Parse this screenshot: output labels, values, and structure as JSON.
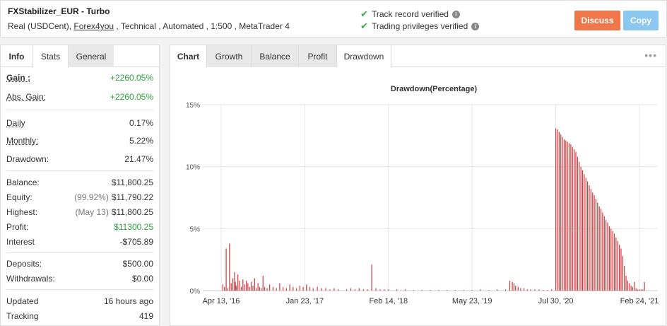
{
  "header": {
    "account_name": "FXStabilizer_EUR - Turbo",
    "sub_prefix": "Real (USDCent), ",
    "broker_link": "Forex4you",
    "sub_suffix": " , Technical , Automated , 1:500 , MetaTrader 4",
    "verified_1": "Track record verified",
    "verified_2": "Trading privileges verified",
    "discuss_label": "Discuss",
    "copy_label": "Copy",
    "colors": {
      "discuss": "#f0774c",
      "copy": "#8cc7ef",
      "check": "#39a845"
    }
  },
  "left_tabs": [
    "Info",
    "Stats",
    "General"
  ],
  "stats": {
    "gain": {
      "label": "Gain :",
      "value": "+2260.05%"
    },
    "abs_gain": {
      "label": "Abs. Gain:",
      "value": "+2260.05%"
    },
    "daily": {
      "label": "Daily",
      "value": "0.17%"
    },
    "monthly": {
      "label": "Monthly:",
      "value": "5.22%"
    },
    "drawdown": {
      "label": "Drawdown:",
      "value": "21.47%"
    },
    "balance": {
      "label": "Balance:",
      "value": "$11,800.25"
    },
    "equity": {
      "label": "Equity:",
      "prefix": "(99.92%)",
      "value": "$11,790.22"
    },
    "highest": {
      "label": "Highest:",
      "prefix": "(May 13)",
      "value": "$11,800.25"
    },
    "profit": {
      "label": "Profit:",
      "value": "$11300.25"
    },
    "interest": {
      "label": "Interest",
      "value": "-$705.89"
    },
    "deposits": {
      "label": "Deposits:",
      "value": "$500.00"
    },
    "withdrawals": {
      "label": "Withdrawals:",
      "value": "$0.00"
    },
    "updated": {
      "label": "Updated",
      "value": "16 hours ago"
    },
    "tracking": {
      "label": "Tracking",
      "value": "419"
    }
  },
  "right_tabs": [
    "Chart",
    "Growth",
    "Balance",
    "Profit",
    "Drawdown"
  ],
  "more_icon": "more-dots-icon",
  "chart_data": {
    "type": "bar",
    "title": "Drawdown(Percentage)",
    "ylim": [
      0,
      15
    ],
    "y_ticks": [
      "0%",
      "5%",
      "10%",
      "15%"
    ],
    "x_ticks": [
      "Apr 13, '16",
      "Jan 23, '17",
      "Feb 14, '18",
      "May 23, '19",
      "Jul 30, '20",
      "Feb 24, '21"
    ],
    "grid": true,
    "bar_color": "#d13b3b",
    "series": [
      {
        "values": [
          [
            0.02,
            0.5
          ],
          [
            0.04,
            0.3
          ],
          [
            0.06,
            3.4
          ],
          [
            0.08,
            0.2
          ],
          [
            0.1,
            3.8
          ],
          [
            0.12,
            0.6
          ],
          [
            0.14,
            1.0
          ],
          [
            0.16,
            1.5
          ],
          [
            0.17,
            0.7
          ],
          [
            0.18,
            0.4
          ],
          [
            0.2,
            1.3
          ],
          [
            0.22,
            0.8
          ],
          [
            0.24,
            0.3
          ],
          [
            0.26,
            0.9
          ],
          [
            0.28,
            0.5
          ],
          [
            0.3,
            0.8
          ],
          [
            0.32,
            0.6
          ],
          [
            0.34,
            0.3
          ],
          [
            0.36,
            0.7
          ],
          [
            0.38,
            0.4
          ],
          [
            0.4,
            1.0
          ],
          [
            0.42,
            0.2
          ],
          [
            0.44,
            0.6
          ],
          [
            0.46,
            0.3
          ],
          [
            0.48,
            0.2
          ],
          [
            0.5,
            1.2
          ],
          [
            0.52,
            0.3
          ],
          [
            0.55,
            0.2
          ],
          [
            0.58,
            0.5
          ],
          [
            0.62,
            0.3
          ],
          [
            0.66,
            0.2
          ],
          [
            0.7,
            0.6
          ],
          [
            0.74,
            0.3
          ],
          [
            0.78,
            0.2
          ],
          [
            0.82,
            0.5
          ],
          [
            0.86,
            0.3
          ],
          [
            0.9,
            0.2
          ],
          [
            0.94,
            0.4
          ],
          [
            0.98,
            0.3
          ],
          [
            1.02,
            0.5
          ],
          [
            1.06,
            0.3
          ],
          [
            1.1,
            0.2
          ],
          [
            1.15,
            0.3
          ],
          [
            1.2,
            0.2
          ],
          [
            1.25,
            0.2
          ],
          [
            1.3,
            0.1
          ],
          [
            1.35,
            0.2
          ],
          [
            1.4,
            0.1
          ],
          [
            1.5,
            0.1
          ],
          [
            1.55,
            0.2
          ],
          [
            1.6,
            0.1
          ],
          [
            1.65,
            0.2
          ],
          [
            1.7,
            0.1
          ],
          [
            1.75,
            0.1
          ],
          [
            1.8,
            2.1
          ],
          [
            1.85,
            0.2
          ],
          [
            1.9,
            0.1
          ],
          [
            1.95,
            0.1
          ],
          [
            2.0,
            0.1
          ],
          [
            2.1,
            0.1
          ],
          [
            2.2,
            0.1
          ],
          [
            2.3,
            0.05
          ],
          [
            2.4,
            0.05
          ],
          [
            2.5,
            0.05
          ],
          [
            2.6,
            0.05
          ],
          [
            2.7,
            0.05
          ],
          [
            2.8,
            0.05
          ],
          [
            2.9,
            0.05
          ],
          [
            3.0,
            0.05
          ],
          [
            3.1,
            0.1
          ],
          [
            3.2,
            0.05
          ],
          [
            3.3,
            0.1
          ],
          [
            3.4,
            0.1
          ],
          [
            3.45,
            0.8
          ],
          [
            3.48,
            0.7
          ],
          [
            3.5,
            0.6
          ],
          [
            3.52,
            0.4
          ],
          [
            3.55,
            0.3
          ],
          [
            3.58,
            0.2
          ],
          [
            3.62,
            0.2
          ],
          [
            3.66,
            0.1
          ],
          [
            3.7,
            0.1
          ],
          [
            3.75,
            0.1
          ],
          [
            3.8,
            0.1
          ],
          [
            3.85,
            0.05
          ],
          [
            3.9,
            0.05
          ],
          [
            3.95,
            0.1
          ],
          [
            4.0,
            13.1
          ],
          [
            4.02,
            13.0
          ],
          [
            4.04,
            12.8
          ],
          [
            4.06,
            12.6
          ],
          [
            4.08,
            12.4
          ],
          [
            4.1,
            12.2
          ],
          [
            4.12,
            12.1
          ],
          [
            4.14,
            12.0
          ],
          [
            4.16,
            11.9
          ],
          [
            4.18,
            11.8
          ],
          [
            4.2,
            11.6
          ],
          [
            4.22,
            11.4
          ],
          [
            4.24,
            11.2
          ],
          [
            4.26,
            10.8
          ],
          [
            4.28,
            10.4
          ],
          [
            4.3,
            10.0
          ],
          [
            4.32,
            9.7
          ],
          [
            4.34,
            9.4
          ],
          [
            4.36,
            9.1
          ],
          [
            4.38,
            8.8
          ],
          [
            4.4,
            8.5
          ],
          [
            4.42,
            8.2
          ],
          [
            4.44,
            7.9
          ],
          [
            4.46,
            7.7
          ],
          [
            4.48,
            7.4
          ],
          [
            4.5,
            7.1
          ],
          [
            4.52,
            6.8
          ],
          [
            4.54,
            6.6
          ],
          [
            4.56,
            6.3
          ],
          [
            4.58,
            6.0
          ],
          [
            4.6,
            5.7
          ],
          [
            4.62,
            5.5
          ],
          [
            4.64,
            5.2
          ],
          [
            4.66,
            5.0
          ],
          [
            4.68,
            4.8
          ],
          [
            4.7,
            4.6
          ],
          [
            4.72,
            4.3
          ],
          [
            4.74,
            4.0
          ],
          [
            4.76,
            3.7
          ],
          [
            4.78,
            3.4
          ],
          [
            4.8,
            2.8
          ],
          [
            4.82,
            2.0
          ],
          [
            4.84,
            1.2
          ],
          [
            4.86,
            0.8
          ],
          [
            4.88,
            0.6
          ],
          [
            4.9,
            0.4
          ],
          [
            4.92,
            0.3
          ],
          [
            4.94,
            0.7
          ],
          [
            4.96,
            0.2
          ],
          [
            4.98,
            0.1
          ],
          [
            5.0,
            0.1
          ],
          [
            5.02,
            0.1
          ],
          [
            5.04,
            0.1
          ],
          [
            5.06,
            0.7
          ]
        ]
      }
    ]
  }
}
